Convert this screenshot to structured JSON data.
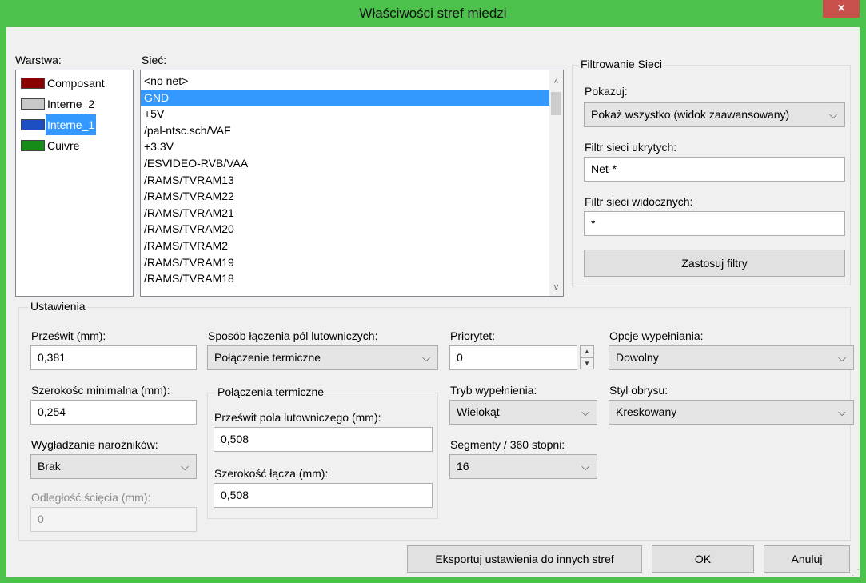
{
  "window": {
    "title": "Właściwości stref miedzi",
    "close_label": "×"
  },
  "layers": {
    "label": "Warstwa:",
    "items": [
      {
        "label": "Composant",
        "color": "#8b0000",
        "selected": false
      },
      {
        "label": "Interne_2",
        "color": "#c8c8c8",
        "selected": false
      },
      {
        "label": "Interne_1",
        "color": "#1e4fc2",
        "selected": true
      },
      {
        "label": "Cuivre",
        "color": "#178b17",
        "selected": false
      }
    ]
  },
  "nets": {
    "label": "Sieć:",
    "items": [
      "<no net>",
      "GND",
      "+5V",
      "/pal-ntsc.sch/VAF",
      "+3.3V",
      "/ESVIDEO-RVB/VAA",
      "/RAMS/TVRAM13",
      "/RAMS/TVRAM22",
      "/RAMS/TVRAM21",
      "/RAMS/TVRAM20",
      "/RAMS/TVRAM2",
      "/RAMS/TVRAM19",
      "/RAMS/TVRAM18"
    ],
    "selected_index": 1,
    "scroll_up_icon": "chevron-up-icon",
    "scroll_down_icon": "chevron-down-icon"
  },
  "filter": {
    "group_title": "Filtrowanie Sieci",
    "show_label": "Pokazuj:",
    "show_value": "Pokaż wszystko (widok zaawansowany)",
    "hidden_label": "Filtr sieci ukrytych:",
    "hidden_value": "Net-*",
    "visible_label": "Filtr sieci widocznych:",
    "visible_value": "*",
    "apply_button": "Zastosuj filtry"
  },
  "settings": {
    "group_title": "Ustawienia",
    "clearance_label": "Prześwit (mm):",
    "clearance_value": "0,381",
    "min_width_label": "Szerokośc minimalna (mm):",
    "min_width_value": "0,254",
    "corner_label": "Wygładzanie narożników:",
    "corner_value": "Brak",
    "chamfer_label": "Odległość ścięcia (mm):",
    "chamfer_value": "0",
    "pad_conn_label": "Sposób łączenia pól lutowniczych:",
    "pad_conn_value": "Połączenie termiczne",
    "thermal_group_title": "Połączenia termiczne",
    "thermal_clearance_label": "Prześwit pola lutowniczego (mm):",
    "thermal_clearance_value": "0,508",
    "spoke_width_label": "Szerokość łącza (mm):",
    "spoke_width_value": "0,508",
    "priority_label": "Priorytet:",
    "priority_value": "0",
    "fill_mode_label": "Tryb wypełnienia:",
    "fill_mode_value": "Wielokąt",
    "segments_label": "Segmenty / 360 stopni:",
    "segments_value": "16",
    "fill_options_label": "Opcje wypełniania:",
    "fill_options_value": "Dowolny",
    "outline_label": "Styl obrysu:",
    "outline_value": "Kreskowany"
  },
  "buttons": {
    "export": "Eksportuj ustawienia do innych stref",
    "ok": "OK",
    "cancel": "Anuluj"
  },
  "glyphs": {
    "chevron": "⌵",
    "up": "▲",
    "down": "▼",
    "scroll_up": "^",
    "scroll_down": "v",
    "grip": "⋰"
  }
}
